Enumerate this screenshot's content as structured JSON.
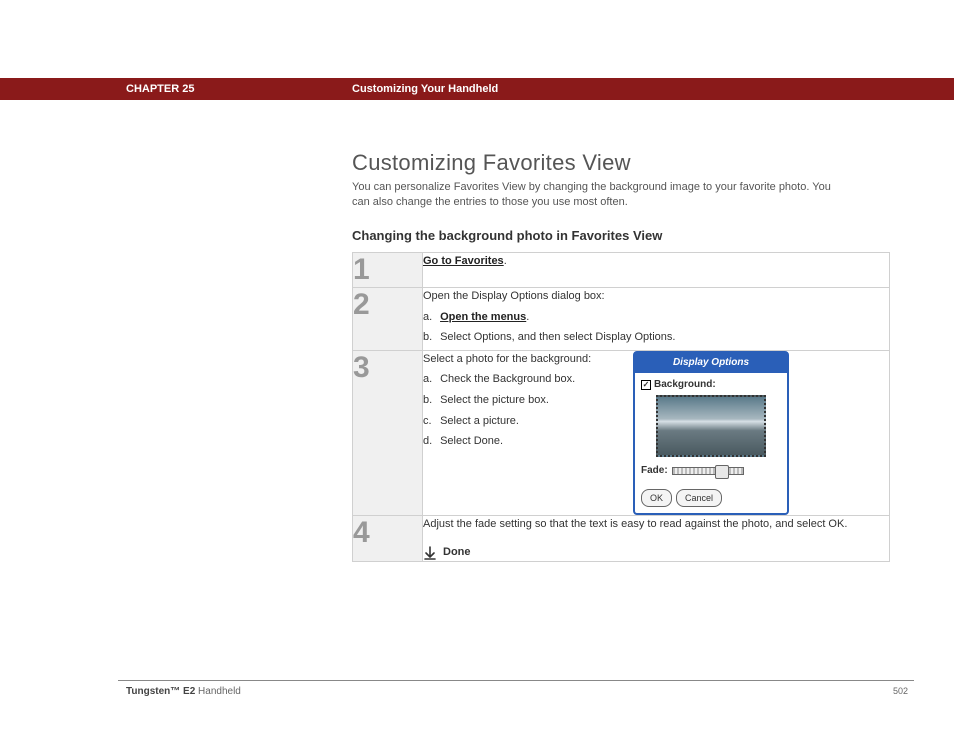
{
  "header": {
    "chapter": "CHAPTER 25",
    "title": "Customizing Your Handheld"
  },
  "section": {
    "title": "Customizing Favorites View",
    "intro": "You can personalize Favorites View by changing the background image to your favorite photo. You can also change the entries to those you use most often.",
    "subtitle": "Changing the background photo in Favorites View"
  },
  "steps": {
    "s1": {
      "num": "1",
      "link": "Go to Favorites",
      "period": "."
    },
    "s2": {
      "num": "2",
      "lead": "Open the Display Options dialog box:",
      "a_label": "a.",
      "a_link": "Open the menus",
      "a_period": ".",
      "b_label": "b.",
      "b_text": "Select Options, and then select Display Options."
    },
    "s3": {
      "num": "3",
      "lead": "Select a photo for the background:",
      "a_label": "a.",
      "a_text": "Check the Background box.",
      "b_label": "b.",
      "b_text": "Select the picture box.",
      "c_label": "c.",
      "c_text": "Select a picture.",
      "d_label": "d.",
      "d_text": "Select Done."
    },
    "s4": {
      "num": "4",
      "text": "Adjust the fade setting so that the text is easy to read against the photo, and select OK.",
      "done": "Done"
    }
  },
  "dialog": {
    "title": "Display Options",
    "check": "✓",
    "bg_label": "Background:",
    "fade_label": "Fade:",
    "ok": "OK",
    "cancel": "Cancel"
  },
  "footer": {
    "product_bold": "Tungsten™ E2",
    "product_rest": " Handheld",
    "page": "502"
  }
}
